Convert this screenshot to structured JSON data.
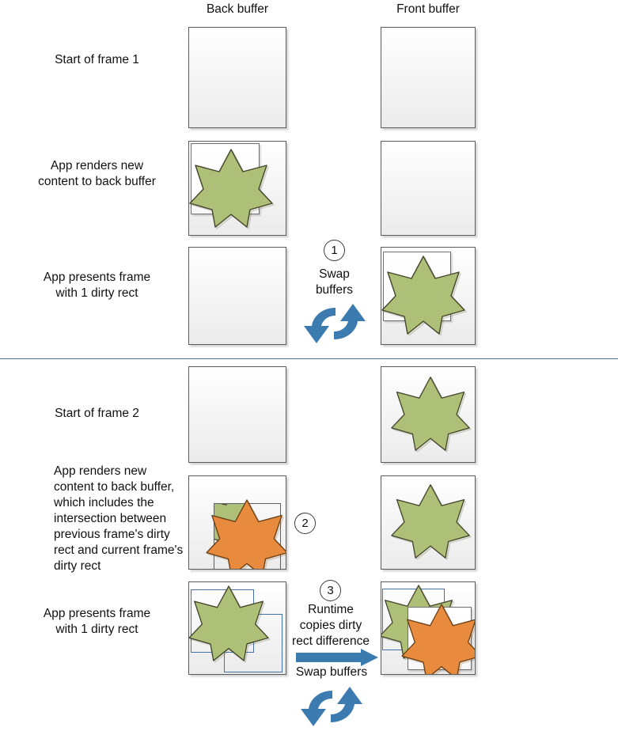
{
  "headers": {
    "back_buffer": "Back buffer",
    "front_buffer": "Front buffer"
  },
  "rows": [
    {
      "id": "row1",
      "caption": "Start of frame 1"
    },
    {
      "id": "row2",
      "caption": "App renders new\ncontent to back buffer"
    },
    {
      "id": "row3",
      "caption": "App presents frame\nwith 1 dirty rect"
    },
    {
      "id": "row4",
      "caption": "Start of frame 2"
    },
    {
      "id": "row5",
      "caption": "App renders new content to back buffer, which includes the intersection between previous frame's dirty rect and current frame's dirty rect"
    },
    {
      "id": "row6",
      "caption": "App presents frame\nwith 1 dirty rect"
    }
  ],
  "row_captions": {
    "row1": "Start of frame 1",
    "row2_line1": "App renders new",
    "row2_line2": "content to back buffer",
    "row3_line1": "App presents frame",
    "row3_line2": "with 1 dirty rect",
    "row4": "Start of frame 2",
    "row5": "App renders new content to back buffer, which includes the intersection between previous frame's dirty rect and current frame's dirty rect",
    "row6_line1": "App presents frame",
    "row6_line2": "with 1 dirty rect"
  },
  "steps": [
    {
      "number": "1",
      "label_line1": "Swap",
      "label_line2": "buffers",
      "icon": "swap-buffers-icon"
    },
    {
      "number": "2",
      "label_line1": "",
      "label_line2": "",
      "icon": ""
    },
    {
      "number": "3",
      "label_line1": "Runtime",
      "label_line2": "copies dirty",
      "label_line3": "rect difference",
      "label_line4": "Swap buffers",
      "icon": "copy-arrow-icon"
    }
  ],
  "step1": {
    "number": "1",
    "label": "Swap\nbuffers",
    "label_line1": "Swap",
    "label_line2": "buffers"
  },
  "step2": {
    "number": "2"
  },
  "step3": {
    "number": "3",
    "label_line1": "Runtime",
    "label_line2": "copies dirty",
    "label_line3": "rect difference",
    "swap_label": "Swap buffers"
  },
  "colors": {
    "star_green_fill": "#AEC078",
    "star_green_stroke": "#4a4a2e",
    "star_orange_fill": "#E98B3E",
    "star_orange_stroke": "#6b4117",
    "buffer_border": "#5b5b5b",
    "dirty_rect_border": "#6e6e6e",
    "blue_rect_border": "#4472a8",
    "divider": "#4a74a8",
    "swap_arrow": "#3C7BB0"
  },
  "icons": {
    "swap_buffers": "swap-buffers-icon",
    "copy_arrow": "right-arrow-icon"
  }
}
